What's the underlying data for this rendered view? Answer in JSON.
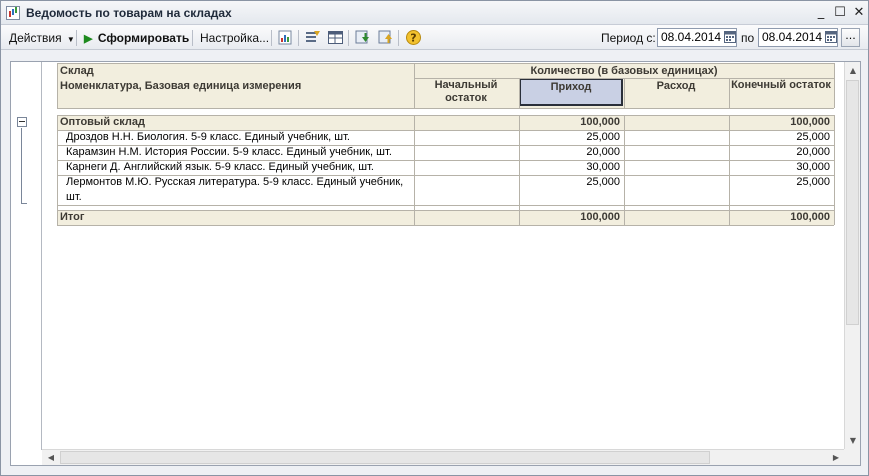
{
  "window": {
    "title": "Ведомость по товарам на складах",
    "controls": {
      "minimize": "_",
      "maximize": "☐",
      "close": "✕"
    }
  },
  "toolbar": {
    "actions_label": "Действия",
    "generate_label": "Сформировать",
    "settings_label": "Настройка...",
    "period_from_label": "Период с:",
    "period_from_value": "08.04.2014",
    "period_to_label": "по",
    "period_to_value": "08.04.2014",
    "select_period_label": "...",
    "accent_green": "#1e8a1e",
    "icons": [
      "chart-icon",
      "filter-icon",
      "table-settings-icon",
      "save-variant-icon",
      "load-variant-icon",
      "help-icon"
    ]
  },
  "report": {
    "header": {
      "col1_row1": "Склад",
      "col1_row2": "Номенклатура, Базовая единица измерения",
      "qty_group": "Количество (в базовых единицах)",
      "opening": "Начальный остаток",
      "receipt": "Приход",
      "expense": "Расход",
      "closing": "Конечный остаток"
    },
    "group": {
      "name": "Оптовый склад",
      "opening": "",
      "receipt": "100,000",
      "expense": "",
      "closing": "100,000"
    },
    "rows": [
      {
        "name": "Дроздов Н.Н. Биология. 5-9 класс. Единый учебник, шт.",
        "opening": "",
        "receipt": "25,000",
        "expense": "",
        "closing": "25,000"
      },
      {
        "name": "Карамзин Н.М. История России. 5-9 класс. Единый учебник, шт.",
        "opening": "",
        "receipt": "20,000",
        "expense": "",
        "closing": "20,000"
      },
      {
        "name": "Карнеги Д. Английский язык. 5-9 класс. Единый учебник, шт.",
        "opening": "",
        "receipt": "30,000",
        "expense": "",
        "closing": "30,000"
      },
      {
        "name_line1": "Лермонтов М.Ю. Русская литература. 5-9 класс. Единый учебник,",
        "name_line2": "шт.",
        "opening": "",
        "receipt": "25,000",
        "expense": "",
        "closing": "25,000"
      }
    ],
    "total": {
      "label": "Итог",
      "opening": "",
      "receipt": "100,000",
      "expense": "",
      "closing": "100,000"
    },
    "colors": {
      "header_bg": "#f2eede",
      "selected_header_bg": "#c9d0e4"
    }
  }
}
